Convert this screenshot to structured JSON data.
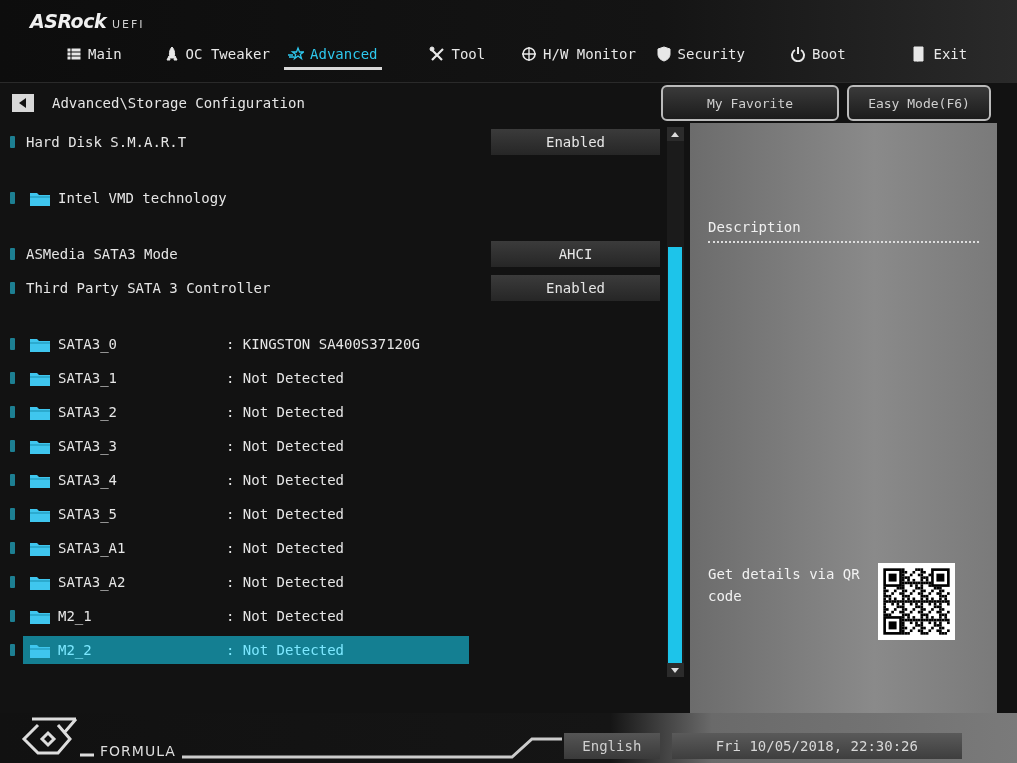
{
  "logo": {
    "brand": "ASRock",
    "suffix": "UEFI"
  },
  "tabs": [
    {
      "label": "Main",
      "selected": false
    },
    {
      "label": "OC Tweaker",
      "selected": false
    },
    {
      "label": "Advanced",
      "selected": true
    },
    {
      "label": "Tool",
      "selected": false
    },
    {
      "label": "H/W Monitor",
      "selected": false
    },
    {
      "label": "Security",
      "selected": false
    },
    {
      "label": "Boot",
      "selected": false
    },
    {
      "label": "Exit",
      "selected": false
    }
  ],
  "breadcrumb": "Advanced\\Storage Configuration",
  "top_buttons": [
    "My Favorite",
    "Easy Mode(F6)"
  ],
  "sections": [
    [
      {
        "kind": "setting",
        "label": "Hard Disk S.M.A.R.T",
        "value": "Enabled",
        "selected": false
      }
    ],
    [
      {
        "kind": "folder",
        "label": "Intel VMD technology",
        "selected": false
      }
    ],
    [
      {
        "kind": "setting",
        "label": "ASMedia SATA3 Mode",
        "value": "AHCI",
        "selected": false
      },
      {
        "kind": "setting",
        "label": "Third Party SATA 3 Controller",
        "value": "Enabled",
        "selected": false
      }
    ],
    [
      {
        "kind": "folder",
        "label": "SATA3_0",
        "value": ": KINGSTON SA400S37120G",
        "selected": false
      },
      {
        "kind": "folder",
        "label": "SATA3_1",
        "value": ": Not Detected",
        "selected": false
      },
      {
        "kind": "folder",
        "label": "SATA3_2",
        "value": ": Not Detected",
        "selected": false
      },
      {
        "kind": "folder",
        "label": "SATA3_3",
        "value": ": Not Detected",
        "selected": false
      },
      {
        "kind": "folder",
        "label": "SATA3_4",
        "value": ": Not Detected",
        "selected": false
      },
      {
        "kind": "folder",
        "label": "SATA3_5",
        "value": ": Not Detected",
        "selected": false
      },
      {
        "kind": "folder",
        "label": "SATA3_A1",
        "value": ": Not Detected",
        "selected": false
      },
      {
        "kind": "folder",
        "label": "SATA3_A2",
        "value": ": Not Detected",
        "selected": false
      },
      {
        "kind": "folder",
        "label": "M2_1",
        "value": ": Not Detected",
        "selected": false
      },
      {
        "kind": "folder",
        "label": "M2_2",
        "value": ": Not Detected",
        "selected": true
      }
    ]
  ],
  "description": {
    "title": "Description",
    "qr_text": "Get details via QR code"
  },
  "footer": {
    "brand": "FORMULA",
    "language": "English",
    "datetime": "Fri 10/05/2018, 22:30:26"
  }
}
